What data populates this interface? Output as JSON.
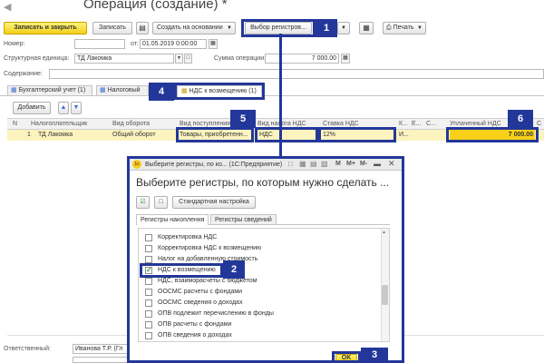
{
  "header": {
    "title": "Операция (создание) *"
  },
  "toolbar": {
    "save_close": "Записать и закрыть",
    "save": "Записать",
    "create_based": "Создать на основании",
    "select_registers": "Выбор регистров...",
    "print": "Печать"
  },
  "form": {
    "number_label": "Номер:",
    "number_value": "",
    "date_label": "от:",
    "date_value": "01.05.2019  0:00:00",
    "unit_label": "Структурная единица:",
    "unit_value": "ТД Лакомка",
    "sum_label": "Сумма операции:",
    "sum_value": "7 000.00",
    "content_label": "Содержание:",
    "content_value": ""
  },
  "tabs": [
    {
      "label": "Бухгалтерский учет (1)"
    },
    {
      "label": "Налоговый"
    },
    {
      "label": "НДС к возмещению (1)"
    }
  ],
  "table": {
    "add_button": "Добавить",
    "columns": [
      "N",
      "Налогоплательщик",
      "Вид оборота",
      "Вид поступления",
      "Вид налога НДС",
      "Ставка НДС",
      "К...",
      "Е...",
      "С...",
      "Уплаченный НДС",
      "С"
    ],
    "rows": [
      {
        "n": "1",
        "taxpayer": "ТД Лакомка",
        "turnover": "Общий оборот",
        "receipt": "Товары, приобретенн...",
        "tax_kind": "НДС",
        "rate": "12%",
        "k": "И...",
        "paid": "7 000.00"
      }
    ]
  },
  "footer": {
    "responsible_label": "Ответственный:",
    "responsible_value": "Иванова Т.Р. (Гл"
  },
  "dialog": {
    "titlebar": "Выберите регистры, по ко... (1С:Предприятие)",
    "titlebar_buttons": [
      "M",
      "M+",
      "M-"
    ],
    "heading": "Выберите регистры, по которым нужно сделать ...",
    "std_settings": "Стандартная настройка",
    "tabs": [
      "Регистры накопления",
      "Регистры сведений"
    ],
    "registers": [
      {
        "label": "Корректировка НДС",
        "checked": false
      },
      {
        "label": "Корректировка НДС к возмещению",
        "checked": false
      },
      {
        "label": "Налог на добавленную стоимость",
        "checked": false
      },
      {
        "label": "НДС к возмещению",
        "checked": true
      },
      {
        "label": "НДС, взаиморасчеты с бюджетом",
        "checked": false
      },
      {
        "label": "ООСМС расчеты с фондами",
        "checked": false
      },
      {
        "label": "ООСМС сведения о доходах",
        "checked": false
      },
      {
        "label": "ОПВ подлежит перечислению в фонды",
        "checked": false
      },
      {
        "label": "ОПВ расчеты с фондами",
        "checked": false
      },
      {
        "label": "ОПВ сведения о доходах",
        "checked": false
      }
    ],
    "ok": "OK"
  },
  "callouts": [
    "1",
    "2",
    "3",
    "4",
    "5",
    "6"
  ],
  "colors": {
    "accent": "#23379a",
    "row_highlight": "#fcf3bf",
    "cell_yellow": "#f7d117",
    "button_yellow": "#f2cf19"
  }
}
